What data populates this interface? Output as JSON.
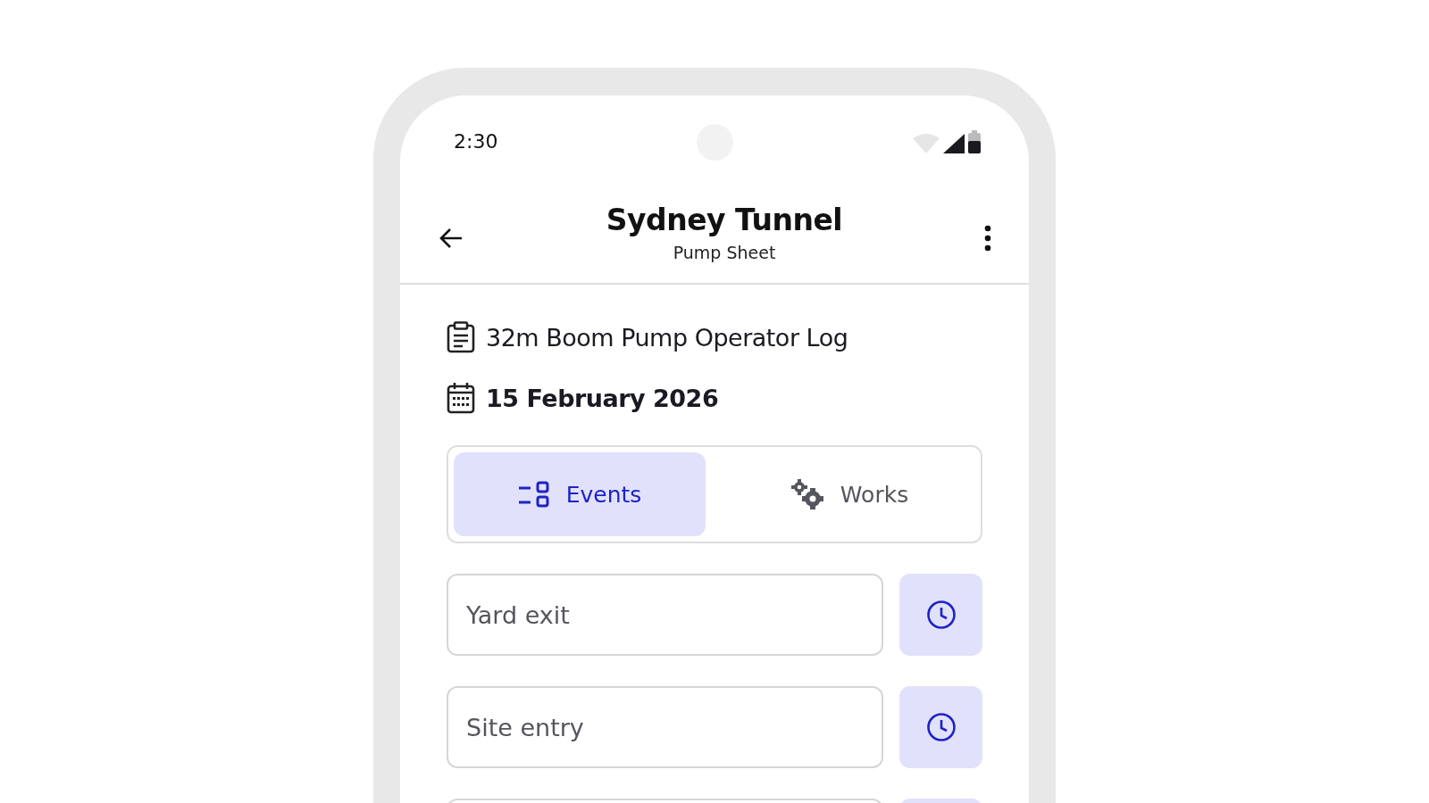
{
  "status_bar": {
    "time": "2:30"
  },
  "header": {
    "title": "Sydney Tunnel",
    "subtitle": "Pump Sheet"
  },
  "info": [
    {
      "kind": "document",
      "text": "32m Boom Pump Operator Log"
    },
    {
      "kind": "date",
      "text": "15 February 2026"
    }
  ],
  "tabs": [
    {
      "kind": "events",
      "label": "Events",
      "selected": true
    },
    {
      "kind": "works",
      "label": "Works",
      "selected": false
    }
  ],
  "fields": [
    {
      "kind": "time",
      "placeholder": "Yard exit"
    },
    {
      "kind": "time",
      "placeholder": "Site entry"
    },
    {
      "kind": "time"
    }
  ]
}
